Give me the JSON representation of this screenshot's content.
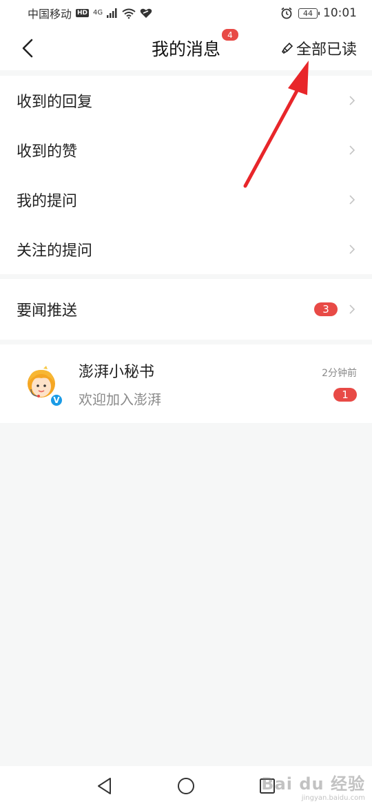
{
  "status_bar": {
    "carrier": "中国移动",
    "hd": "HD",
    "network": "4G",
    "battery": "44",
    "time": "10:01"
  },
  "nav": {
    "title": "我的消息",
    "title_badge": "4",
    "read_all_label": "全部已读"
  },
  "menu": {
    "items": [
      {
        "label": "收到的回复"
      },
      {
        "label": "收到的赞"
      },
      {
        "label": "我的提问"
      },
      {
        "label": "关注的提问"
      }
    ]
  },
  "push": {
    "label": "要闻推送",
    "badge": "3"
  },
  "message": {
    "name": "澎湃小秘书",
    "preview": "欢迎加入澎湃",
    "time": "2分钟前",
    "badge": "1",
    "verified": "V"
  },
  "watermark": {
    "main": "Bai du 经验",
    "url": "jingyan.baidu.com"
  },
  "colors": {
    "accent_red": "#e84a46",
    "verified_blue": "#1a9be6",
    "background": "#f6f7f7"
  },
  "icons": [
    "back-chevron-icon",
    "broom-icon",
    "chevron-right-icon",
    "triangle-back-icon",
    "circle-home-icon",
    "square-recents-icon"
  ]
}
